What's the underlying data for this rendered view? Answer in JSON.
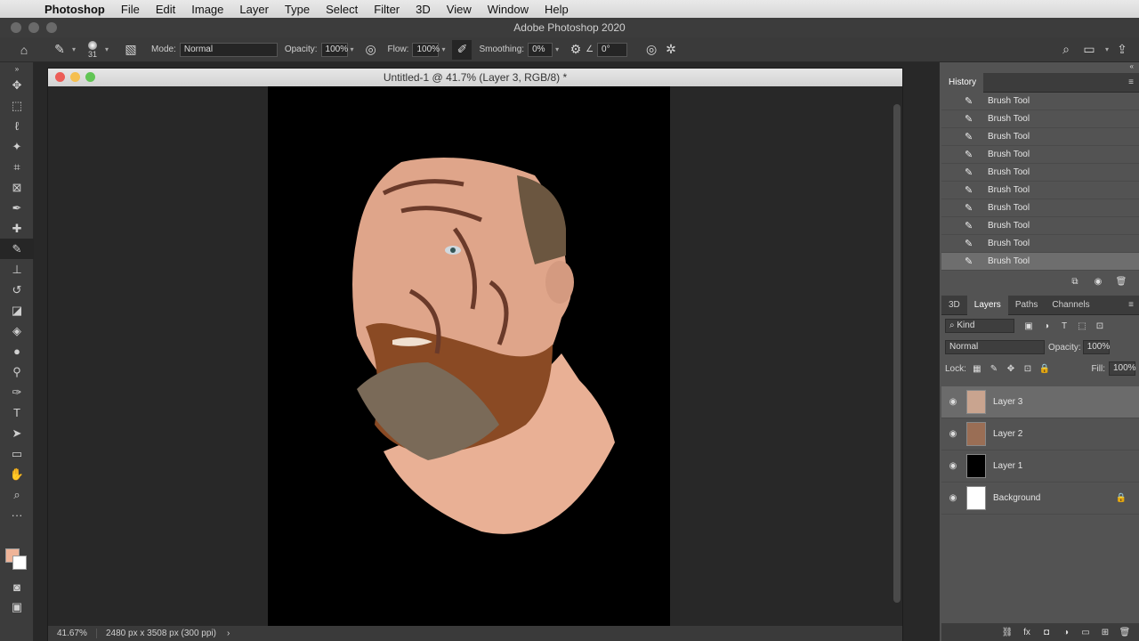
{
  "menubar": {
    "app": "Photoshop",
    "items": [
      "File",
      "Edit",
      "Image",
      "Layer",
      "Type",
      "Select",
      "Filter",
      "3D",
      "View",
      "Window",
      "Help"
    ]
  },
  "window": {
    "title": "Adobe Photoshop 2020"
  },
  "options": {
    "brush_size": "31",
    "mode_label": "Mode:",
    "mode_value": "Normal",
    "opacity_label": "Opacity:",
    "opacity_value": "100%",
    "flow_label": "Flow:",
    "flow_value": "100%",
    "smoothing_label": "Smoothing:",
    "smoothing_value": "0%",
    "angle_value": "0°"
  },
  "document": {
    "title": "Untitled-1 @ 41.7% (Layer 3, RGB/8) *",
    "zoom": "41.67%",
    "dimensions": "2480 px x 3508 px (300 ppi)"
  },
  "colors": {
    "foreground": "#efb498",
    "background": "#ffffff"
  },
  "history": {
    "title": "History",
    "items": [
      "Brush Tool",
      "Brush Tool",
      "Brush Tool",
      "Brush Tool",
      "Brush Tool",
      "Brush Tool",
      "Brush Tool",
      "Brush Tool",
      "Brush Tool",
      "Brush Tool"
    ]
  },
  "layers_panel": {
    "tabs": [
      "3D",
      "Layers",
      "Paths",
      "Channels"
    ],
    "filter": "Kind",
    "blend_mode": "Normal",
    "opacity_label": "Opacity:",
    "opacity_value": "100%",
    "lock_label": "Lock:",
    "fill_label": "Fill:",
    "fill_value": "100%",
    "layers": [
      "Layer 3",
      "Layer 2",
      "Layer 1",
      "Background"
    ]
  }
}
